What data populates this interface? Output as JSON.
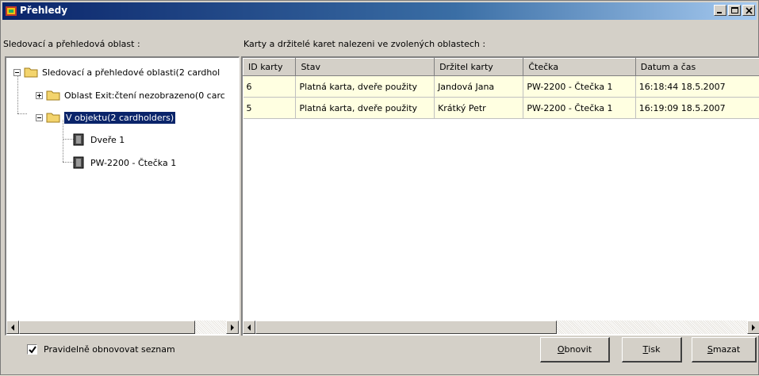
{
  "window": {
    "title": "Přehledy"
  },
  "left": {
    "label": "Sledovací a přehledová oblast :",
    "tree": {
      "root": "Sledovací a přehledové oblasti(2 cardhol",
      "exit": "Oblast Exit:čtení nezobrazeno(0 carc",
      "inside": "V objektu(2 cardholders)",
      "door": "Dveře 1",
      "reader": "PW-2200 - Čtečka 1"
    }
  },
  "right": {
    "label": "Karty a držitelé karet nalezeni ve zvolených oblastech :",
    "columns": [
      "ID karty",
      "Stav",
      "Držitel karty",
      "Čtečka",
      "Datum a čas"
    ],
    "rows": [
      [
        "6",
        "Platná karta, dveře použity",
        "Jandová Jana",
        "PW-2200 - Čtečka 1",
        "16:18:44 18.5.2007"
      ],
      [
        "5",
        "Platná karta, dveře použity",
        "Krátký Petr",
        "PW-2200 - Čtečka 1",
        "16:19:09 18.5.2007"
      ]
    ]
  },
  "bottom": {
    "auto_refresh_label": "Pravidelně obnovovat seznam",
    "auto_refresh_checked": true,
    "refresh_first": "O",
    "refresh_rest": "bnovit",
    "print_first": "T",
    "print_rest": "isk",
    "delete_first": "S",
    "delete_rest": "mazat"
  },
  "colors": {
    "titlebar": "#0a246a",
    "selection": "#0a246a",
    "row_bg": "#ffffe1",
    "face": "#d4d0c8"
  }
}
